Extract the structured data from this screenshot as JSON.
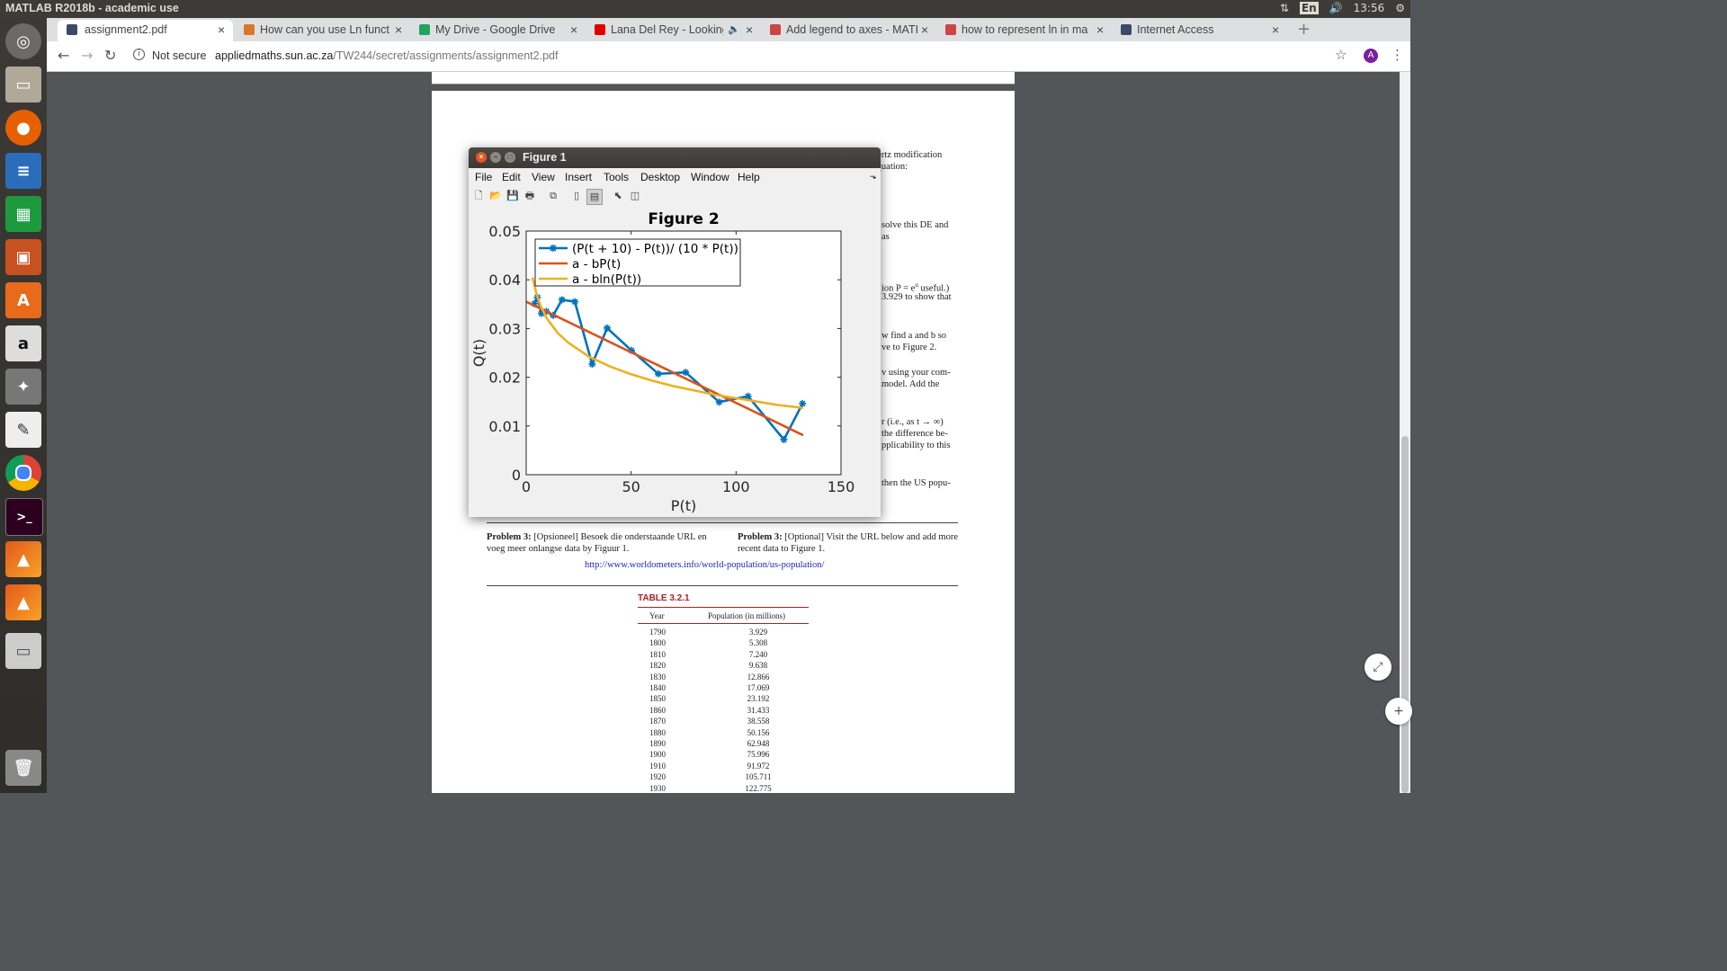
{
  "topbar": {
    "title": "MATLAB R2018b - academic use",
    "lang": "En",
    "time": "13:56"
  },
  "browser": {
    "tabs": [
      {
        "label": "assignment2.pdf",
        "fav": "#3b4a6b",
        "active": true
      },
      {
        "label": "How can you use Ln funct",
        "fav": "#d9772a",
        "active": false
      },
      {
        "label": "My Drive - Google Drive",
        "fav": "#1fa463",
        "active": false
      },
      {
        "label": "Lana Del Rey - Looking",
        "fav": "#e00000",
        "active": false
      },
      {
        "label": "Add legend to axes - MATI",
        "fav": "#c44",
        "active": false
      },
      {
        "label": "how to represent ln in ma",
        "fav": "#c44",
        "active": false
      },
      {
        "label": "Internet Access",
        "fav": "#3b4a6b",
        "active": false
      }
    ],
    "security": "Not secure",
    "url_host": "appliedmaths.sun.ac.za",
    "url_path": "/TW244/secret/assignments/assignment2.pdf",
    "avatar": "A"
  },
  "pdf": {
    "snippets": [
      "pertz modification",
      "equation:",
      "solve this DE and",
      "as",
      "ion P = e",
      "u",
      " useful.)",
      "3.929 to show that",
      "w find a and b so",
      "ve to Figure 2.",
      "v using your com-",
      "model.  Add the",
      "r (i.e., as t → ∞)",
      "the difference be-",
      "pplicability to this",
      "then the US popu-"
    ],
    "problem3_af_bold": "Problem 3:",
    "problem3_af": " [Opsioneel] Besoek die onderstaande URL en voeg meer onlangse data by Figuur 1.",
    "problem3_en_bold": "Problem 3:",
    "problem3_en": " [Optional] Visit the URL below and add more recent data to Figure 1.",
    "url": "http://www.worldometers.info/world-population/us-population/",
    "table_title": "TABLE 3.2.1",
    "col_year": "Year",
    "col_pop": "Population (in millions)",
    "rows": [
      [
        "1790",
        "3.929"
      ],
      [
        "1800",
        "5.308"
      ],
      [
        "1810",
        "7.240"
      ],
      [
        "1820",
        "9.638"
      ],
      [
        "1830",
        "12.866"
      ],
      [
        "1840",
        "17.069"
      ],
      [
        "1850",
        "23.192"
      ],
      [
        "1860",
        "31.433"
      ],
      [
        "1870",
        "38.558"
      ],
      [
        "1880",
        "50.156"
      ],
      [
        "1890",
        "62.948"
      ],
      [
        "1900",
        "75.996"
      ],
      [
        "1910",
        "91.972"
      ],
      [
        "1920",
        "105.711"
      ],
      [
        "1930",
        "122.775"
      ]
    ]
  },
  "figure": {
    "window_title": "Figure 1",
    "menu": [
      "File",
      "Edit",
      "View",
      "Insert",
      "Tools",
      "Desktop",
      "Window",
      "Help"
    ],
    "close_label": "×",
    "min_label": "–",
    "max_label": "□"
  },
  "chart_data": {
    "type": "line",
    "title": "Figure 2",
    "xlabel": "P(t)",
    "ylabel": "Q(t)",
    "xlim": [
      0,
      150
    ],
    "ylim": [
      0,
      0.05
    ],
    "xticks": [
      "0",
      "50",
      "100",
      "150"
    ],
    "yticks": [
      "0",
      "0.01",
      "0.02",
      "0.03",
      "0.04",
      "0.05"
    ],
    "grid": false,
    "legend_position": "top-left",
    "series": [
      {
        "name": "(P(t + 10) - P(t))/ (10 * P(t))",
        "color": "#0072bd",
        "marker": "star",
        "x": [
          3.929,
          5.308,
          7.24,
          9.638,
          12.866,
          17.069,
          23.192,
          31.433,
          38.558,
          50.156,
          62.948,
          75.996,
          91.972,
          105.711,
          122.775,
          131.669
        ],
        "y": [
          0.0351,
          0.0364,
          0.0331,
          0.0335,
          0.0327,
          0.0359,
          0.0355,
          0.0227,
          0.0301,
          0.0255,
          0.0207,
          0.021,
          0.0149,
          0.0161,
          0.0072,
          0.0146
        ]
      },
      {
        "name": "a - bP(t)",
        "color": "#d95319",
        "x": [
          0,
          132
        ],
        "y": [
          0.0355,
          0.0081
        ]
      },
      {
        "name": "a - bln(P(t))",
        "color": "#edb120",
        "x": [
          3,
          5,
          7,
          10,
          15,
          20,
          30,
          40,
          50,
          60,
          70,
          80,
          90,
          100,
          110,
          120,
          132
        ],
        "y": [
          0.0405,
          0.0369,
          0.0345,
          0.032,
          0.0291,
          0.0271,
          0.0242,
          0.0222,
          0.0206,
          0.0193,
          0.0182,
          0.0173,
          0.0164,
          0.0157,
          0.015,
          0.0143,
          0.0137
        ]
      }
    ]
  }
}
